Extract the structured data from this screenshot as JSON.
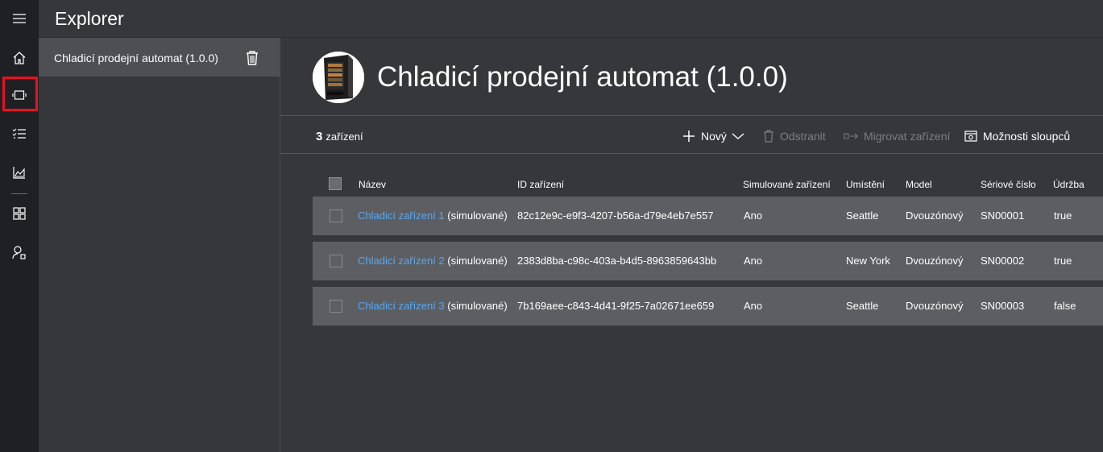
{
  "app": {
    "title": "Explorer"
  },
  "rail": {
    "items": [
      {
        "icon": "hamburger-icon"
      },
      {
        "icon": "home-icon"
      },
      {
        "icon": "device-icon",
        "highlighted": true
      },
      {
        "icon": "checklist-icon"
      },
      {
        "icon": "analytics-icon"
      },
      {
        "icon": "dashboard-grid-icon"
      },
      {
        "icon": "admin-user-icon"
      }
    ],
    "highlight_color": "#e81123"
  },
  "templates": {
    "items": [
      {
        "label": "Chladicí prodejní automat (1.0.0)"
      }
    ]
  },
  "main": {
    "title": "Chladicí prodejní automat (1.0.0)",
    "device_count": "3",
    "device_count_label": "zařízení"
  },
  "toolbar": {
    "new_label": "Nový",
    "delete_label": "Odstranit",
    "migrate_label": "Migrovat zařízení",
    "columns_label": "Možnosti sloupců"
  },
  "table": {
    "headers": [
      "Název",
      "ID zařízení",
      "Simulované zařízení",
      "Umístění",
      "Model",
      "Sériové číslo",
      "Údržba"
    ],
    "rows": [
      {
        "name": "Chladicí zařízení 1",
        "suffix": "(simulované)",
        "id": "82c12e9c-e9f3-4207-b56a-d79e4eb7e557",
        "simulated": "Ano",
        "location": "Seattle",
        "model": "Dvouzónový",
        "serial": "SN00001",
        "maintenance": "true"
      },
      {
        "name": "Chladicí zařízení 2",
        "suffix": "(simulované)",
        "id": "2383d8ba-c98c-403a-b4d5-8963859643bb",
        "simulated": "Ano",
        "location": "New York",
        "model": "Dvouzónový",
        "serial": "SN00002",
        "maintenance": "true"
      },
      {
        "name": "Chladicí zařízení 3",
        "suffix": "(simulované)",
        "id": "7b169aee-c843-4d41-9f25-7a02671ee659",
        "simulated": "Ano",
        "location": "Seattle",
        "model": "Dvouzónový",
        "serial": "SN00003",
        "maintenance": "false"
      }
    ]
  },
  "colors": {
    "link": "#5aa7ee",
    "rail_bg": "#1f2023",
    "panel_bg": "#36373b",
    "row_bg": "#5d5e62"
  }
}
